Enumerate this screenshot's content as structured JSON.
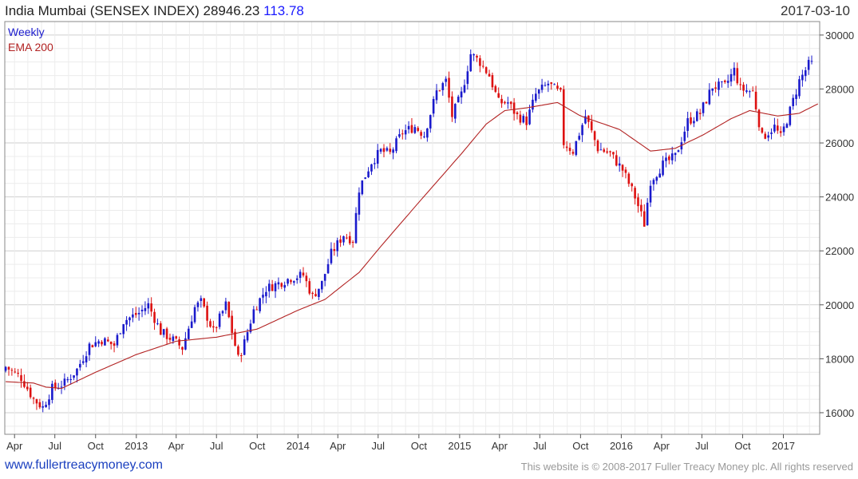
{
  "header": {
    "title": "India Mumbai (SENSEX INDEX)",
    "last": "28946.23",
    "change": "113.78",
    "date": "2017-03-10"
  },
  "footer": {
    "site": "www.fullertreacymoney.com",
    "copyright": "This website is © 2008-2017 Fuller Treacy Money plc. All rights reserved"
  },
  "colors": {
    "up": "#1a1acc",
    "down": "#dd1111",
    "ema": "#b22222",
    "grid": "#e6e6e6"
  },
  "chart_data": {
    "type": "candlestick",
    "title": "India Mumbai (SENSEX INDEX)",
    "ylim": [
      15200,
      30500
    ],
    "y_ticks": [
      16000,
      18000,
      20000,
      22000,
      24000,
      26000,
      28000,
      30000
    ],
    "x_ticks": [
      {
        "date": "2012-04-01",
        "label": "Apr"
      },
      {
        "date": "2012-07-01",
        "label": "Jul"
      },
      {
        "date": "2012-10-01",
        "label": "Oct"
      },
      {
        "date": "2013-01-01",
        "label": "2013"
      },
      {
        "date": "2013-04-01",
        "label": "Apr"
      },
      {
        "date": "2013-07-01",
        "label": "Jul"
      },
      {
        "date": "2013-10-01",
        "label": "Oct"
      },
      {
        "date": "2014-01-01",
        "label": "2014"
      },
      {
        "date": "2014-04-01",
        "label": "Apr"
      },
      {
        "date": "2014-07-01",
        "label": "Jul"
      },
      {
        "date": "2014-10-01",
        "label": "Oct"
      },
      {
        "date": "2015-01-01",
        "label": "2015"
      },
      {
        "date": "2015-04-01",
        "label": "Apr"
      },
      {
        "date": "2015-07-01",
        "label": "Jul"
      },
      {
        "date": "2015-10-01",
        "label": "Oct"
      },
      {
        "date": "2016-01-01",
        "label": "2016"
      },
      {
        "date": "2016-04-01",
        "label": "Apr"
      },
      {
        "date": "2016-07-01",
        "label": "Jul"
      },
      {
        "date": "2016-10-01",
        "label": "Oct"
      },
      {
        "date": "2017-01-01",
        "label": "2017"
      }
    ],
    "legend": [
      {
        "label": "Weekly",
        "color": "#1a1acc"
      },
      {
        "label": "EMA 200",
        "color": "#b22222"
      }
    ],
    "x_range": [
      "2012-03-10",
      "2017-03-24"
    ],
    "close_anchors": [
      [
        "2012-03-12",
        17700
      ],
      [
        "2012-04-16",
        17300
      ],
      [
        "2012-05-14",
        16500
      ],
      [
        "2012-06-04",
        16200
      ],
      [
        "2012-06-25",
        16900
      ],
      [
        "2012-07-23",
        17100
      ],
      [
        "2012-08-20",
        17600
      ],
      [
        "2012-09-17",
        18500
      ],
      [
        "2012-10-15",
        18700
      ],
      [
        "2012-11-12",
        18500
      ],
      [
        "2012-12-03",
        19400
      ],
      [
        "2013-01-07",
        19700
      ],
      [
        "2013-01-28",
        20000
      ],
      [
        "2013-02-25",
        19000
      ],
      [
        "2013-03-25",
        18700
      ],
      [
        "2013-04-15",
        18400
      ],
      [
        "2013-05-13",
        19900
      ],
      [
        "2013-05-27",
        20100
      ],
      [
        "2013-06-24",
        19000
      ],
      [
        "2013-07-22",
        20000
      ],
      [
        "2013-08-19",
        18000
      ],
      [
        "2013-09-02",
        18600
      ],
      [
        "2013-09-23",
        19800
      ],
      [
        "2013-10-21",
        20600
      ],
      [
        "2013-11-18",
        20800
      ],
      [
        "2013-12-16",
        21000
      ],
      [
        "2014-01-13",
        21100
      ],
      [
        "2014-02-03",
        20300
      ],
      [
        "2014-02-24",
        20800
      ],
      [
        "2014-03-17",
        21900
      ],
      [
        "2014-04-14",
        22600
      ],
      [
        "2014-05-05",
        22400
      ],
      [
        "2014-05-19",
        24300
      ],
      [
        "2014-06-16",
        25300
      ],
      [
        "2014-07-07",
        25700
      ],
      [
        "2014-07-28",
        25600
      ],
      [
        "2014-08-25",
        26400
      ],
      [
        "2014-09-22",
        26600
      ],
      [
        "2014-10-13",
        26300
      ],
      [
        "2014-11-10",
        27900
      ],
      [
        "2014-12-01",
        28300
      ],
      [
        "2014-12-15",
        27000
      ],
      [
        "2015-01-05",
        27800
      ],
      [
        "2015-01-26",
        29300
      ],
      [
        "2015-02-16",
        29000
      ],
      [
        "2015-03-09",
        28500
      ],
      [
        "2015-03-30",
        27500
      ],
      [
        "2015-04-20",
        27500
      ],
      [
        "2015-05-11",
        27000
      ],
      [
        "2015-06-01",
        26800
      ],
      [
        "2015-06-22",
        27800
      ],
      [
        "2015-07-20",
        28200
      ],
      [
        "2015-08-17",
        27800
      ],
      [
        "2015-08-24",
        26000
      ],
      [
        "2015-09-14",
        25700
      ],
      [
        "2015-10-12",
        27000
      ],
      [
        "2015-11-09",
        25800
      ],
      [
        "2015-12-07",
        25600
      ],
      [
        "2016-01-04",
        25000
      ],
      [
        "2016-02-01",
        24000
      ],
      [
        "2016-02-22",
        23000
      ],
      [
        "2016-03-07",
        24600
      ],
      [
        "2016-04-04",
        25200
      ],
      [
        "2016-05-02",
        25500
      ],
      [
        "2016-05-30",
        26800
      ],
      [
        "2016-06-27",
        27100
      ],
      [
        "2016-07-25",
        28100
      ],
      [
        "2016-08-22",
        28100
      ],
      [
        "2016-09-12",
        28700
      ],
      [
        "2016-09-26",
        28000
      ],
      [
        "2016-10-24",
        27900
      ],
      [
        "2016-11-14",
        26200
      ],
      [
        "2016-12-12",
        26600
      ],
      [
        "2016-12-26",
        26200
      ],
      [
        "2017-01-16",
        27200
      ],
      [
        "2017-02-06",
        28300
      ],
      [
        "2017-02-27",
        28900
      ],
      [
        "2017-03-10",
        28946
      ]
    ],
    "ema_anchors": [
      [
        "2012-03-12",
        17150
      ],
      [
        "2012-05-14",
        17100
      ],
      [
        "2012-06-11",
        16950
      ],
      [
        "2012-07-16",
        16900
      ],
      [
        "2012-10-01",
        17500
      ],
      [
        "2012-12-31",
        18150
      ],
      [
        "2013-04-01",
        18650
      ],
      [
        "2013-07-01",
        18800
      ],
      [
        "2013-10-01",
        19100
      ],
      [
        "2014-01-01",
        19800
      ],
      [
        "2014-03-03",
        20200
      ],
      [
        "2014-05-19",
        21200
      ],
      [
        "2014-07-14",
        22300
      ],
      [
        "2014-10-01",
        23800
      ],
      [
        "2015-01-05",
        25600
      ],
      [
        "2015-03-02",
        26700
      ],
      [
        "2015-04-13",
        27200
      ],
      [
        "2015-06-01",
        27300
      ],
      [
        "2015-08-10",
        27500
      ],
      [
        "2015-10-01",
        27000
      ],
      [
        "2015-12-28",
        26500
      ],
      [
        "2016-03-07",
        25700
      ],
      [
        "2016-05-02",
        25800
      ],
      [
        "2016-07-04",
        26300
      ],
      [
        "2016-09-05",
        26900
      ],
      [
        "2016-10-17",
        27200
      ],
      [
        "2016-12-19",
        27000
      ],
      [
        "2017-02-06",
        27100
      ],
      [
        "2017-03-20",
        27450
      ]
    ]
  }
}
